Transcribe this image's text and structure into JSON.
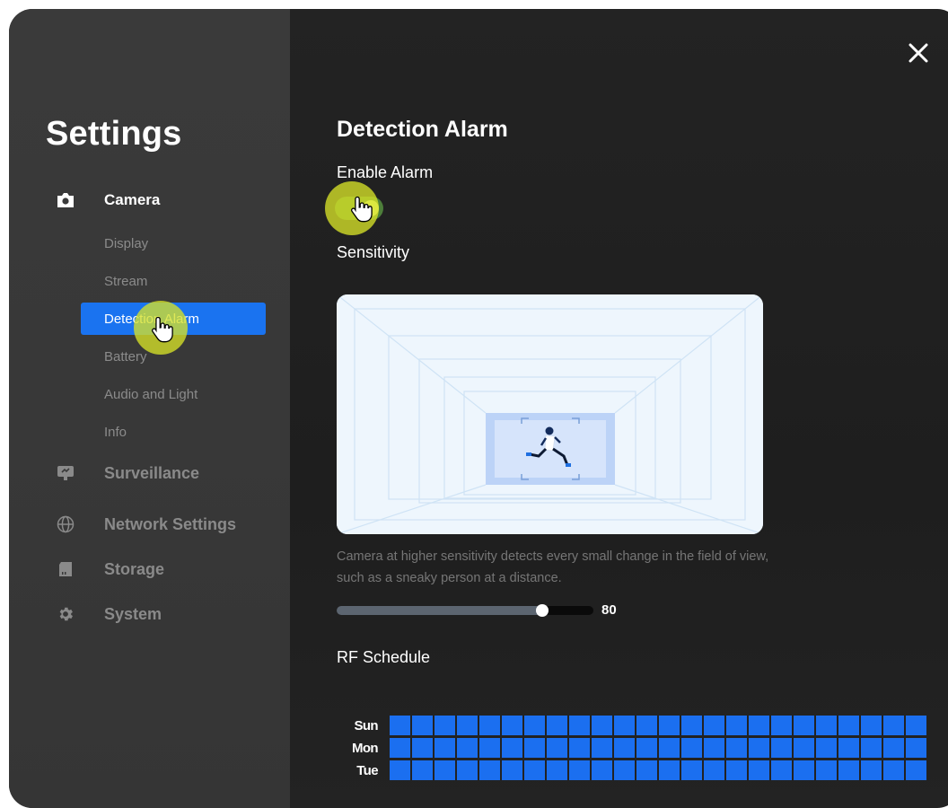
{
  "sidebar": {
    "title": "Settings",
    "sections": [
      {
        "label": "Camera",
        "icon": "camera-icon",
        "active": true
      },
      {
        "label": "Surveillance",
        "icon": "monitor-icon"
      },
      {
        "label": "Network Settings",
        "icon": "globe-icon"
      },
      {
        "label": "Storage",
        "icon": "storage-card-icon"
      },
      {
        "label": "System",
        "icon": "gear-icon"
      }
    ],
    "camera_items": [
      {
        "label": "Display"
      },
      {
        "label": "Stream"
      },
      {
        "label": "Detection Alarm",
        "selected": true
      },
      {
        "label": "Battery"
      },
      {
        "label": "Audio and Light"
      },
      {
        "label": "Info"
      }
    ]
  },
  "main": {
    "title": "Detection Alarm",
    "enable_alarm_label": "Enable Alarm",
    "enable_alarm_on": true,
    "sensitivity_label": "Sensitivity",
    "sensitivity_description": "Camera at higher sensitivity detects every small change in the field of view, such as a sneaky person at a distance.",
    "sensitivity_value": 80,
    "sensitivity_display": "80",
    "schedule_label": "RF Schedule",
    "schedule_days": [
      "Sun",
      "Mon",
      "Tue"
    ],
    "schedule_hours_per_day": 24
  },
  "colors": {
    "accent": "#1a73f0",
    "schedule_cell": "#1b6ff0",
    "toggle_on": "#4d7e3a",
    "click_highlight": "#d6e228"
  },
  "icons": {
    "close": "close-icon",
    "cursor": "hand-pointer-icon"
  }
}
